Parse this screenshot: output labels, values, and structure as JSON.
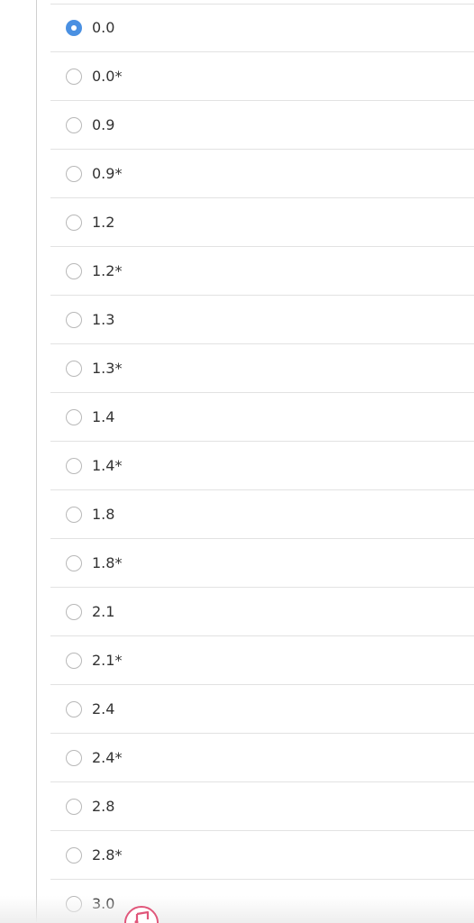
{
  "selected_value": "0.0",
  "options": [
    {
      "label": "0.0",
      "checked": true
    },
    {
      "label": "0.0*",
      "checked": false
    },
    {
      "label": "0.9",
      "checked": false
    },
    {
      "label": "0.9*",
      "checked": false
    },
    {
      "label": "1.2",
      "checked": false
    },
    {
      "label": "1.2*",
      "checked": false
    },
    {
      "label": "1.3",
      "checked": false
    },
    {
      "label": "1.3*",
      "checked": false
    },
    {
      "label": "1.4",
      "checked": false
    },
    {
      "label": "1.4*",
      "checked": false
    },
    {
      "label": "1.8",
      "checked": false
    },
    {
      "label": "1.8*",
      "checked": false
    },
    {
      "label": "2.1",
      "checked": false
    },
    {
      "label": "2.1*",
      "checked": false
    },
    {
      "label": "2.4",
      "checked": false
    },
    {
      "label": "2.4*",
      "checked": false
    },
    {
      "label": "2.8",
      "checked": false
    },
    {
      "label": "2.8*",
      "checked": false
    },
    {
      "label": "3.0",
      "checked": false
    }
  ],
  "colors": {
    "accent": "#4a90e2",
    "text": "#333333",
    "divider": "#e2e2e2",
    "badge": "#e0567a"
  },
  "badge_icon": "music-note-icon"
}
